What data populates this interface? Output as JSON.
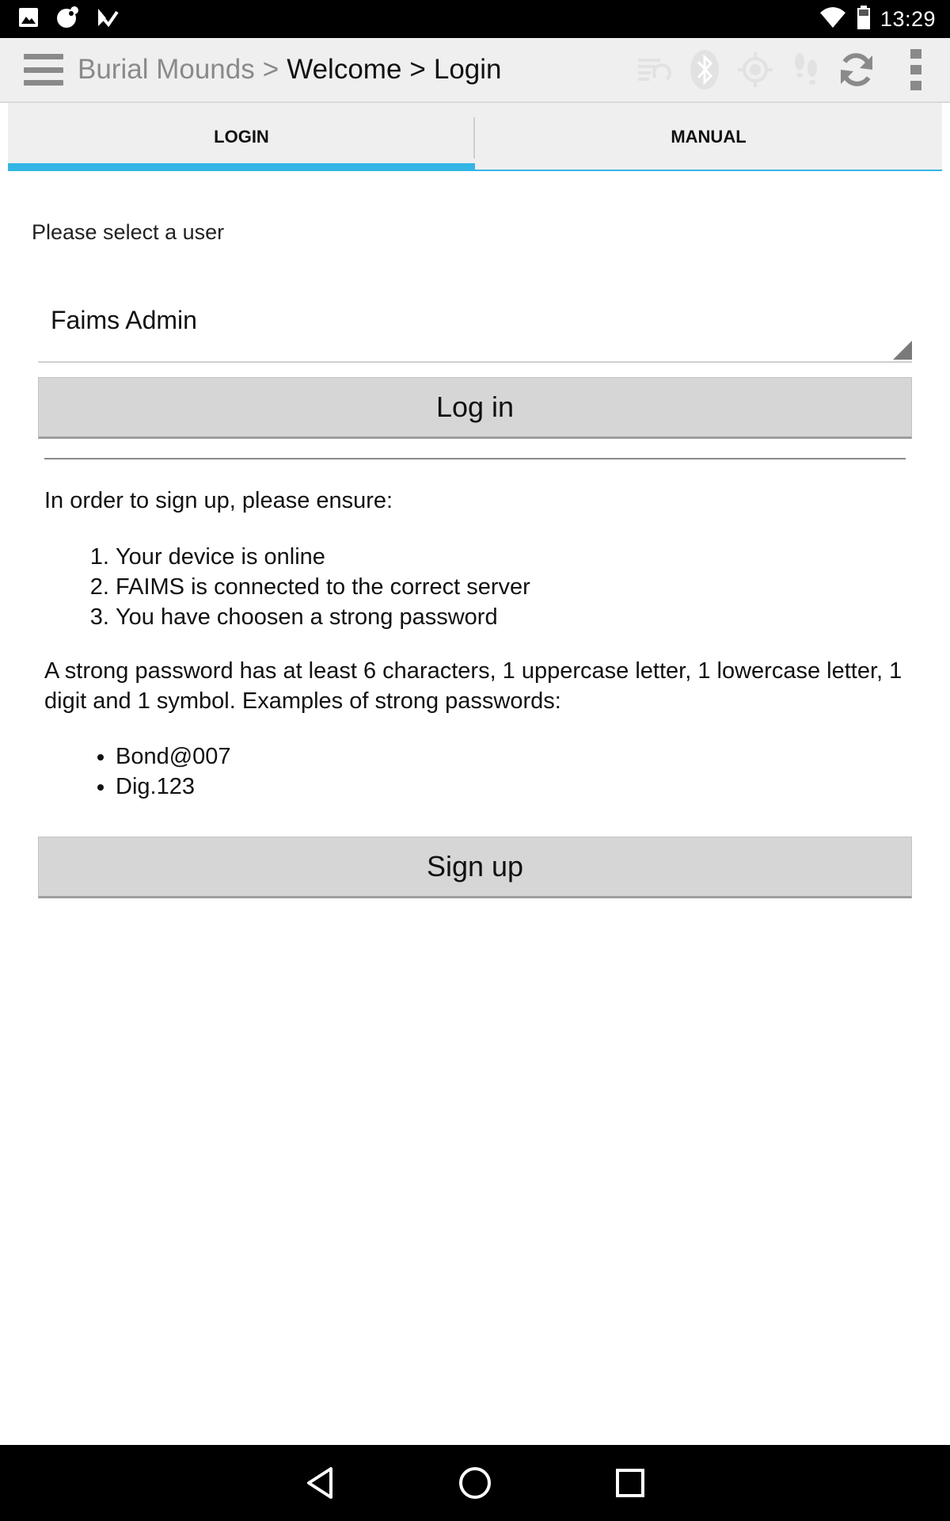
{
  "status_bar": {
    "time": "13:29",
    "left_icons": [
      "image-icon",
      "notification-app-icon",
      "task-check-icon"
    ],
    "right_icons": [
      "wifi-icon",
      "battery-icon"
    ]
  },
  "action_bar": {
    "project": "Burial Mounds",
    "separator1": ">",
    "page": "Welcome",
    "separator2": ">",
    "current": "Login",
    "icons": [
      "sync-status-icon",
      "bluetooth-icon",
      "gps-icon",
      "tracker-icon",
      "sync-icon",
      "overflow-menu-icon"
    ]
  },
  "tabs": [
    {
      "label": "LOGIN",
      "active": true
    },
    {
      "label": "MANUAL",
      "active": false
    }
  ],
  "login": {
    "prompt": "Please select a user",
    "selected_user": "Faims Admin",
    "login_button": "Log in",
    "intro": "In order to sign up, please ensure:",
    "steps": [
      "Your device is online",
      "FAIMS is connected to the correct server",
      "You have choosen a strong password"
    ],
    "strong_password_text": "A strong password has at least 6 characters, 1 uppercase letter, 1 lowercase letter, 1 digit and 1 symbol. Examples of strong passwords:",
    "examples": [
      "Bond@007",
      "Dig.123"
    ],
    "signup_button": "Sign up"
  },
  "colors": {
    "accent": "#33b5e5",
    "button_bg": "#d6d6d6",
    "actionbar_bg": "#efefef"
  }
}
